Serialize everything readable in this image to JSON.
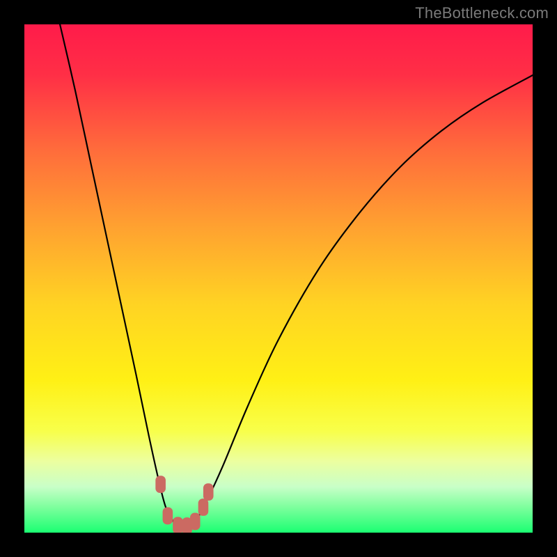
{
  "source_label": "TheBottleneck.com",
  "chart_data": {
    "type": "line",
    "title": "",
    "xlabel": "",
    "ylabel": "",
    "xlim": [
      0,
      100
    ],
    "ylim": [
      0,
      100
    ],
    "legend": false,
    "grid": false,
    "background": {
      "type": "vertical-gradient",
      "stops": [
        {
          "offset": 0.0,
          "color": "#ff1b4a"
        },
        {
          "offset": 0.1,
          "color": "#ff2f46"
        },
        {
          "offset": 0.25,
          "color": "#ff6d3b"
        },
        {
          "offset": 0.4,
          "color": "#ffa230"
        },
        {
          "offset": 0.55,
          "color": "#ffd323"
        },
        {
          "offset": 0.7,
          "color": "#fff015"
        },
        {
          "offset": 0.8,
          "color": "#f8ff4a"
        },
        {
          "offset": 0.86,
          "color": "#ecffa0"
        },
        {
          "offset": 0.91,
          "color": "#c8ffc8"
        },
        {
          "offset": 0.95,
          "color": "#7dff9d"
        },
        {
          "offset": 1.0,
          "color": "#1bff72"
        }
      ]
    },
    "curve": [
      {
        "x": 7.0,
        "y": 100.0
      },
      {
        "x": 10.0,
        "y": 87.0
      },
      {
        "x": 13.0,
        "y": 73.0
      },
      {
        "x": 16.0,
        "y": 59.0
      },
      {
        "x": 19.0,
        "y": 45.0
      },
      {
        "x": 22.0,
        "y": 31.0
      },
      {
        "x": 24.5,
        "y": 19.0
      },
      {
        "x": 26.5,
        "y": 10.0
      },
      {
        "x": 28.0,
        "y": 4.5
      },
      {
        "x": 30.0,
        "y": 1.5
      },
      {
        "x": 32.0,
        "y": 1.2
      },
      {
        "x": 34.0,
        "y": 2.8
      },
      {
        "x": 36.0,
        "y": 6.5
      },
      {
        "x": 39.0,
        "y": 13.0
      },
      {
        "x": 44.0,
        "y": 25.0
      },
      {
        "x": 50.0,
        "y": 38.0
      },
      {
        "x": 58.0,
        "y": 52.0
      },
      {
        "x": 66.0,
        "y": 63.0
      },
      {
        "x": 74.0,
        "y": 72.0
      },
      {
        "x": 82.0,
        "y": 79.0
      },
      {
        "x": 90.0,
        "y": 84.5
      },
      {
        "x": 100.0,
        "y": 90.0
      }
    ],
    "markers": [
      {
        "x": 26.8,
        "y": 9.5
      },
      {
        "x": 28.2,
        "y": 3.3
      },
      {
        "x": 30.2,
        "y": 1.4
      },
      {
        "x": 32.0,
        "y": 1.3
      },
      {
        "x": 33.6,
        "y": 2.2
      },
      {
        "x": 35.2,
        "y": 5.0
      },
      {
        "x": 36.2,
        "y": 8.0
      }
    ],
    "marker_style": {
      "shape": "rounded-rect",
      "color": "#cb6a62",
      "w": 2.0,
      "h": 3.4
    }
  }
}
